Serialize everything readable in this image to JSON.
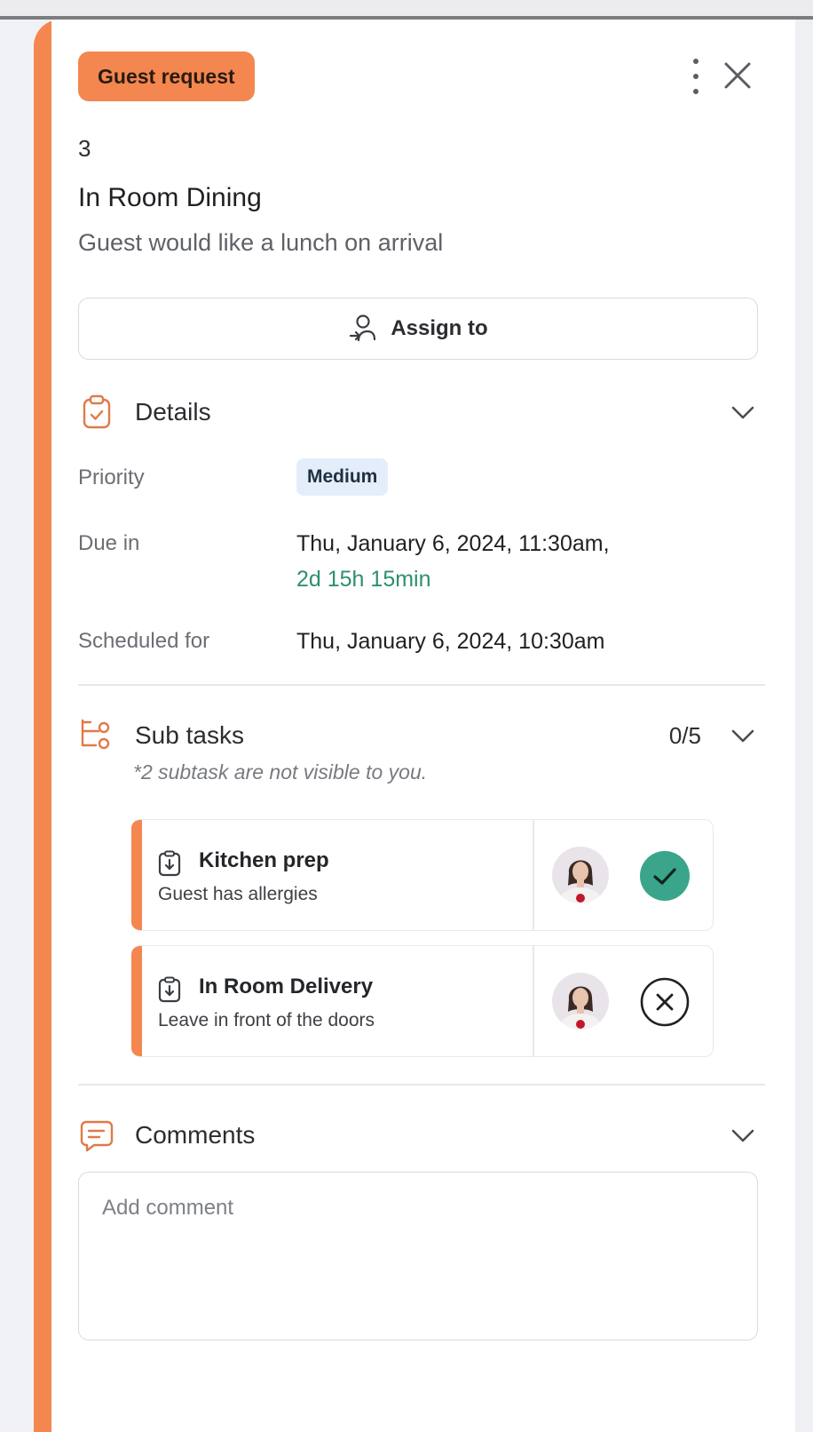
{
  "request": {
    "tag": "Guest request",
    "number": "3",
    "title": "In Room Dining",
    "description": "Guest would like a lunch on arrival"
  },
  "actions": {
    "assign_label": "Assign to"
  },
  "details": {
    "heading": "Details",
    "priority_label": "Priority",
    "priority_value": "Medium",
    "due_label": "Due in",
    "due_value": "Thu, January 6, 2024, 11:30am,",
    "due_remaining": "2d 15h 15min",
    "scheduled_label": "Scheduled for",
    "scheduled_value": "Thu, January 6, 2024, 10:30am"
  },
  "subtasks": {
    "heading": "Sub tasks",
    "count": "0/5",
    "note": "*2 subtask are not visible to you.",
    "items": [
      {
        "title": "Kitchen prep",
        "description": "Guest has allergies",
        "status": "done"
      },
      {
        "title": "In Room Delivery",
        "description": "Leave in front of the doors",
        "status": "cancelled"
      }
    ]
  },
  "comments": {
    "heading": "Comments",
    "placeholder": "Add comment"
  },
  "colors": {
    "accent": "#f3874f",
    "success": "#3aa58a",
    "due_green": "#2e8f6f",
    "priority_bg": "#e4eefa"
  }
}
